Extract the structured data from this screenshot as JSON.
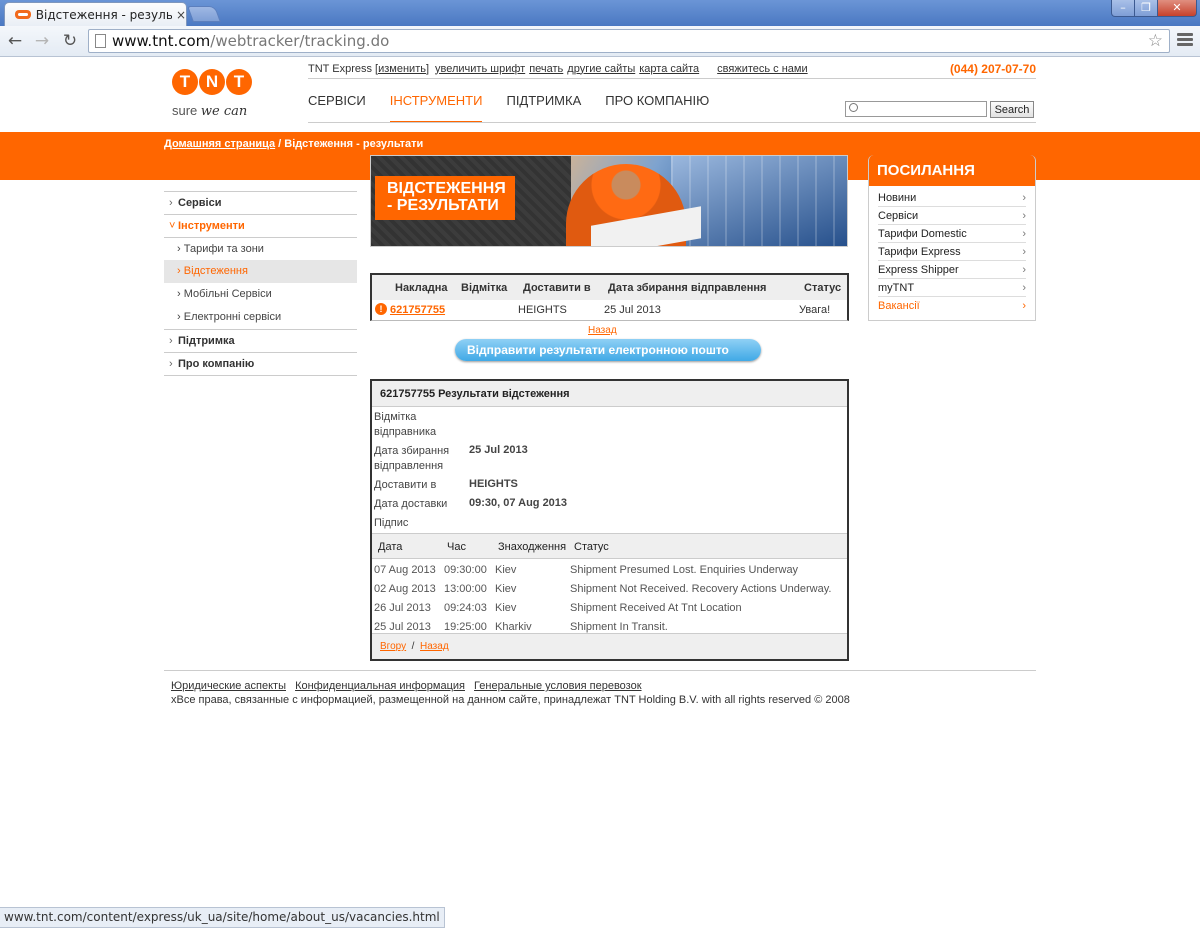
{
  "browser": {
    "tab_title": "Відстеження - резуль",
    "tab_close": "×",
    "url_host": "www.tnt.com",
    "url_path": "/webtracker/tracking.do",
    "status_url": "www.tnt.com/content/express/uk_ua/site/home/about_us/vacancies.html"
  },
  "logo": {
    "letters": [
      "T",
      "N",
      "T"
    ],
    "slogan_a": "sure",
    "slogan_b": "we can"
  },
  "utility": {
    "brand": "TNT Express",
    "change": "[изменить]",
    "links": [
      "увеличить шрифт",
      "печать",
      "другие сайты",
      "карта сайта"
    ],
    "contact": "свяжитесь с нами",
    "phone": "(044) 207-07-70"
  },
  "mainnav": [
    "СЕРВІСИ",
    "ІНСТРУМЕНТИ",
    "ПІДТРИМКА",
    "ПРО КОМПАНІЮ"
  ],
  "search": {
    "button": "Search"
  },
  "breadcrumb": {
    "home": "Домашняя страница",
    "sep": " / ",
    "current": "Відстеження - результати"
  },
  "leftnav": {
    "services": "Сервіси",
    "tools": "Інструменти",
    "sub": [
      "Тарифи та зони",
      "Відстеження",
      "Мобільні Сервіси",
      "Електронні сервіси"
    ],
    "support": "Підтримка",
    "about": "Про компанію"
  },
  "banner": {
    "title_1": "ВІДСТЕЖЕННЯ",
    "title_2": "- РЕЗУЛЬТАТИ"
  },
  "summary": {
    "headers": [
      "Накладна",
      "Відмітка",
      "Доставити в",
      "Дата збирання відправлення",
      "Статус"
    ],
    "row": {
      "consignment": "621757755",
      "reference": "",
      "destination": "HEIGHTS",
      "date": "25 Jul 2013",
      "status": "Увага!"
    }
  },
  "back_label": "Назад",
  "email_button": "Відправити результати електронною пошто",
  "detail": {
    "title": "621757755 Результати відстеження",
    "rows": [
      {
        "label": "Відмітка відправника",
        "value": ""
      },
      {
        "label": "Дата збирання відправлення",
        "value": "25 Jul 2013"
      },
      {
        "label": "Доставити в",
        "value": "HEIGHTS"
      },
      {
        "label": "Дата доставки",
        "value": "09:30, 07 Aug 2013"
      },
      {
        "label": "Підпис",
        "value": ""
      }
    ],
    "event_headers": [
      "Дата",
      "Час",
      "Знаходження",
      "Статус"
    ],
    "events": [
      {
        "date": "07 Aug 2013",
        "time": "09:30:00",
        "location": "Kiev",
        "status": "Shipment Presumed Lost. Enquiries Underway"
      },
      {
        "date": "02 Aug 2013",
        "time": "13:00:00",
        "location": "Kiev",
        "status": "Shipment Not Received. Recovery Actions Underway."
      },
      {
        "date": "26 Jul 2013",
        "time": "09:24:03",
        "location": "Kiev",
        "status": "Shipment Received At Tnt Location"
      },
      {
        "date": "25 Jul 2013",
        "time": "19:25:00",
        "location": "Kharkiv",
        "status": "Shipment In Transit."
      }
    ],
    "footer_up": "Вгору",
    "footer_sep": "/",
    "footer_back": "Назад"
  },
  "links_box": {
    "title": "ПОСИЛАННЯ",
    "items": [
      "Новини",
      "Сервіси",
      "Тарифи Domestic",
      "Тарифи Express",
      "Express Shipper",
      "myTNT",
      "Вакансії"
    ]
  },
  "footer": {
    "links": [
      "Юридические аспекты",
      "Конфиденциальная информация",
      "Генеральные условия перевозок"
    ],
    "copyright": "xВсе права, связанные с информацией, размещенной на данном сайте, принадлежат TNT Holding B.V. with all rights reserved © 2008"
  },
  "colors": {
    "brand": "#ff6600",
    "button_blue": "#40a9e6"
  }
}
